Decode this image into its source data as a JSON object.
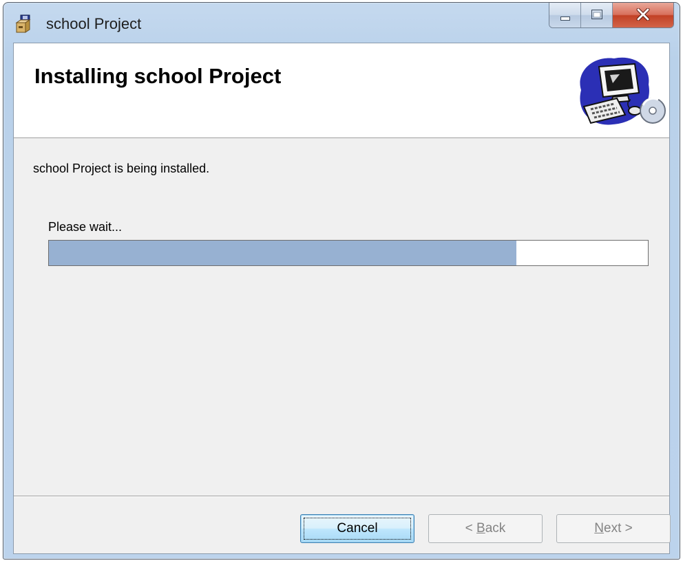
{
  "window": {
    "title": "school Project",
    "controls": {
      "minimize": "minimize-icon",
      "maximize": "maximize-icon",
      "close": "close-icon"
    }
  },
  "banner": {
    "title": "Installing school Project",
    "art_icon": "computer-cd-icon"
  },
  "body": {
    "status_message": "school Project is being installed.",
    "wait_label": "Please wait...",
    "progress_percent": 78
  },
  "buttons": {
    "cancel": "Cancel",
    "back": {
      "prefix": "< ",
      "accel": "B",
      "rest": "ack"
    },
    "next": {
      "accel": "N",
      "rest": "ext >"
    }
  },
  "colors": {
    "progress_fill": "#97b1d2",
    "close_button": "#c24125",
    "titlebar": "#bcd3ec"
  }
}
